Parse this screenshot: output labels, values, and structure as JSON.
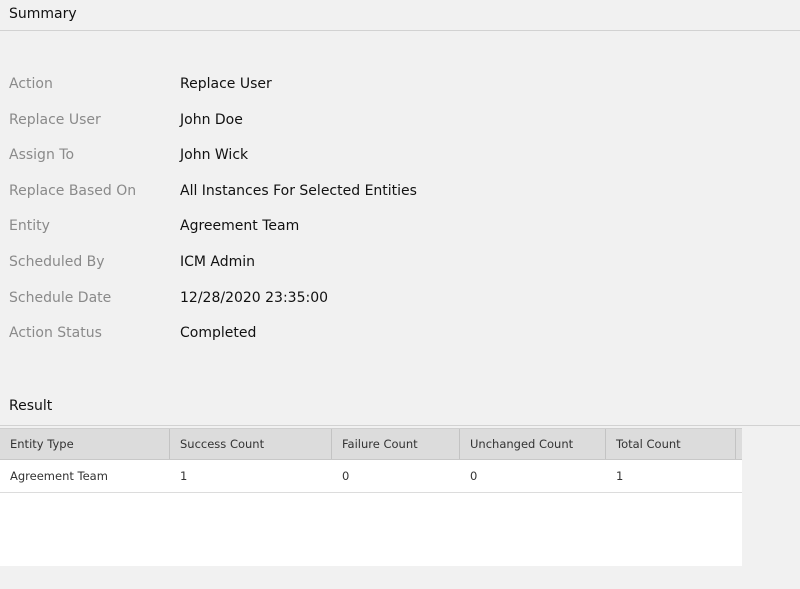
{
  "summary": {
    "title": "Summary",
    "rows": [
      {
        "label": "Action",
        "value": "Replace User"
      },
      {
        "label": "Replace User",
        "value": "John Doe"
      },
      {
        "label": "Assign To",
        "value": "John Wick"
      },
      {
        "label": "Replace Based On",
        "value": "All Instances For Selected Entities"
      },
      {
        "label": "Entity",
        "value": "Agreement Team"
      },
      {
        "label": "Scheduled By",
        "value": "ICM Admin"
      },
      {
        "label": "Schedule Date",
        "value": "12/28/2020 23:35:00"
      },
      {
        "label": "Action Status",
        "value": "Completed"
      }
    ]
  },
  "result": {
    "title": "Result",
    "columns": [
      "Entity Type",
      "Success Count",
      "Failure Count",
      "Unchanged Count",
      "Total Count"
    ],
    "rows": [
      [
        "Agreement Team",
        "1",
        "0",
        "0",
        "1"
      ]
    ]
  },
  "colors": {
    "background": "#f1f1f1",
    "label": "#8a8a8a",
    "grid_header": "#dcdcdc",
    "grid_body": "#ffffff"
  }
}
